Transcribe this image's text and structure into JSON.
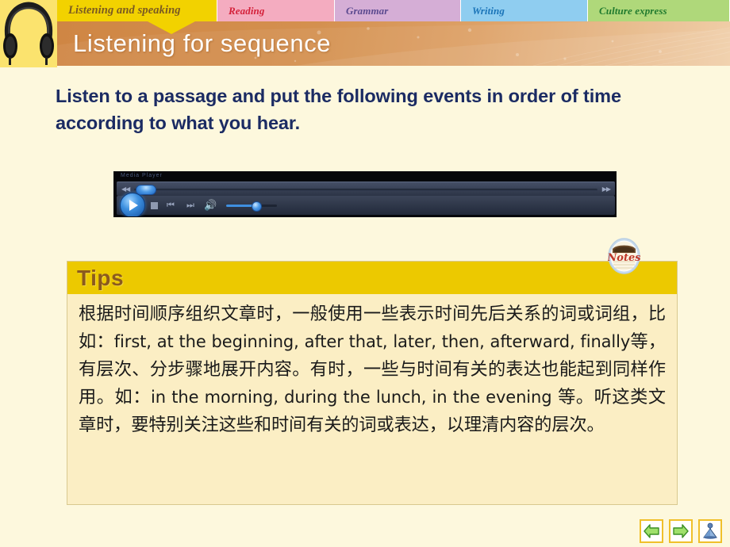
{
  "tabs": [
    {
      "label": "Listening and speaking",
      "active": true,
      "bg": "#f2d200",
      "fg": "#7a5a22"
    },
    {
      "label": "Reading",
      "active": false,
      "bg": "#f4acc0",
      "fg": "#d4213a"
    },
    {
      "label": "Grammar",
      "active": false,
      "bg": "#d5aed6",
      "fg": "#5b4a8f"
    },
    {
      "label": "Writing",
      "active": false,
      "bg": "#8fcdf0",
      "fg": "#1a74b8"
    },
    {
      "label": "Culture express",
      "active": false,
      "bg": "#afd87a",
      "fg": "#1f7a2e"
    }
  ],
  "header": {
    "title": "Listening for sequence",
    "icon": "headphones-icon",
    "banner_color": "#d4904f",
    "title_color": "#ffffff"
  },
  "instruction": {
    "line1": "Listen to a passage and put the following events in order of time",
    "line2": "according to what you hear.",
    "color": "#1b2b63"
  },
  "player": {
    "title_label": "Media Player",
    "right_label": "",
    "play_state": "paused",
    "seek_position_pct": 3,
    "volume_pct": 56,
    "controls": [
      "play-button",
      "stop-button",
      "previous-track-button",
      "next-track-button",
      "volume-button",
      "volume-slider",
      "seek-slider"
    ]
  },
  "tips": {
    "heading": "Tips",
    "heading_bg": "#ecc900",
    "heading_color": "#8b5a1e",
    "body_bg": "#fbeec4",
    "badge_label": "Notes",
    "paragraph_runs": [
      {
        "t": "cn",
        "s": "根据时间顺序组织文章时，一般使用一些表示时间先后关系的词或词组，比如："
      },
      {
        "t": "en",
        "s": "first, at the beginning, after that, later, then, afterward, finally"
      },
      {
        "t": "cn",
        "s": "等，有层次、分步骤地展开内容。有时，一些与时间有关的表达也能起到同样作用。如："
      },
      {
        "t": "en",
        "s": "in the morning, during the lunch, in the evening"
      },
      {
        "t": "cn",
        "s": " 等。听这类文章时，要特别关注这些和时间有关的词或表达，以理清内容的层次。"
      }
    ]
  },
  "nav": {
    "back_label": "Previous",
    "forward_label": "Next",
    "home_label": "Home"
  }
}
